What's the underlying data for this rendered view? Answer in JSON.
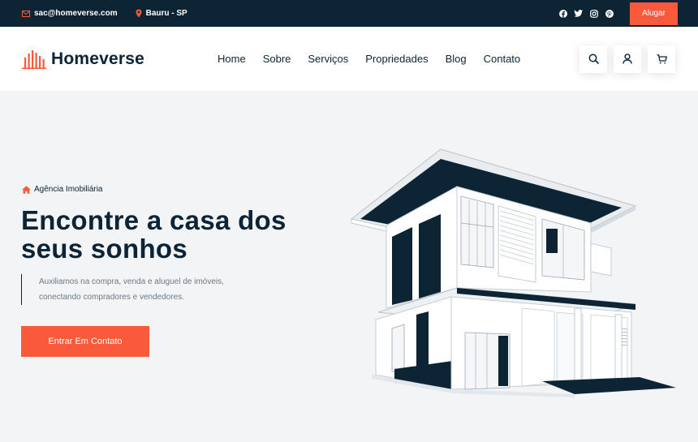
{
  "topbar": {
    "email": "sac@homeverse.com",
    "location": "Bauru - SP",
    "socials": [
      "facebook-icon",
      "twitter-icon",
      "instagram-icon",
      "pinterest-icon"
    ],
    "cta": "Alugar"
  },
  "header": {
    "brand": "Homeverse",
    "nav": [
      "Home",
      "Sobre",
      "Serviços",
      "Propriedades",
      "Blog",
      "Contato"
    ],
    "actions": [
      "search-icon",
      "user-icon",
      "cart-icon"
    ]
  },
  "hero": {
    "subtitle": "Agência Imobiliária",
    "title_line1": "Encontre a casa dos",
    "title_line2": "seus sonhos",
    "desc_line1": "Auxiliamos na compra, venda e aluguel de imóveis,",
    "desc_line2": "conectando compradores e vendedores.",
    "button": "Entrar Em Contato"
  },
  "colors": {
    "accent": "#fa5a3c",
    "navy": "#0c2434",
    "hero_bg": "#f2f4f5"
  }
}
